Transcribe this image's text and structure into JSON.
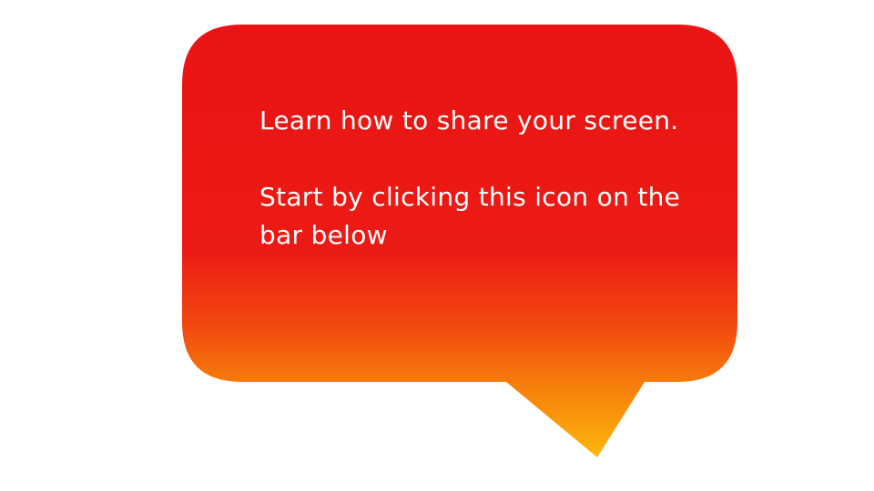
{
  "bubble": {
    "line1": "Learn how to share your screen.",
    "line2": "Start by clicking this icon on the bar below",
    "colors": {
      "top": "#ea1414",
      "mid": "#ec1c14",
      "bottom": "#f67a0c",
      "tail_tip": "#fdb70a",
      "text": "#ffffff"
    }
  }
}
